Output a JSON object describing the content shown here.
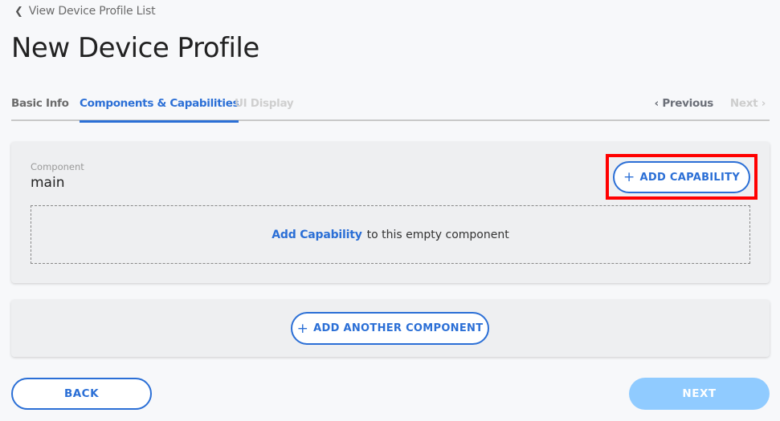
{
  "header": {
    "back_link_icon": "chevron-left-icon",
    "back_link_label": "View Device Profile List",
    "title": "New Device Profile"
  },
  "tabs": [
    {
      "label": "Basic Info",
      "state": "completed"
    },
    {
      "label": "Components & Capabilities",
      "state": "active"
    },
    {
      "label": "UI Display",
      "state": "disabled"
    }
  ],
  "step_nav": {
    "previous_label": "‹ Previous",
    "next_label": "Next ›",
    "next_enabled": false
  },
  "component": {
    "label": "Component",
    "name": "main",
    "add_capability_button": "ADD CAPABILITY",
    "plus_icon": "+",
    "empty_link": "Add Capability",
    "empty_text": "to this empty component"
  },
  "add_component": {
    "plus_icon": "+",
    "label": "ADD ANOTHER COMPONENT"
  },
  "footer": {
    "back_label": "BACK",
    "next_label": "NEXT",
    "next_enabled": false
  },
  "colors": {
    "accent": "#2b6fd6",
    "next_disabled_bg": "#90cbff",
    "highlight": "#ff0000",
    "card_bg": "#eeeff1",
    "page_bg": "#f7f8fa"
  }
}
